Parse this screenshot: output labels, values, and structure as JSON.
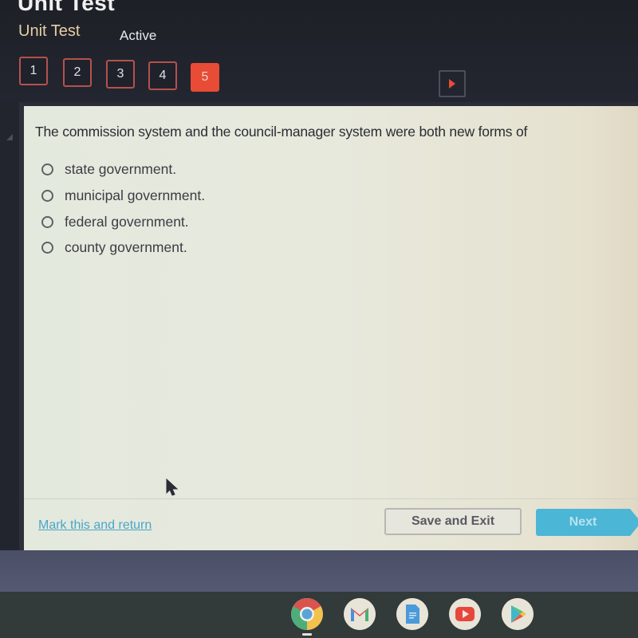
{
  "header": {
    "big_title": "Unit Test",
    "sub_title": "Unit Test",
    "status": "Active"
  },
  "question_nav": {
    "items": [
      {
        "label": "1",
        "active": false
      },
      {
        "label": "2",
        "active": false
      },
      {
        "label": "3",
        "active": false
      },
      {
        "label": "4",
        "active": false
      },
      {
        "label": "5",
        "active": true
      }
    ],
    "next_icon": "play-arrow-icon"
  },
  "question": {
    "text": "The commission system and the council-manager system were both new forms of",
    "options": [
      {
        "label": "state government.",
        "selected": false
      },
      {
        "label": "municipal government.",
        "selected": false
      },
      {
        "label": "federal government.",
        "selected": false
      },
      {
        "label": "county government.",
        "selected": false
      }
    ]
  },
  "footer": {
    "mark_link": "Mark this and return",
    "save_button": "Save and Exit",
    "next_button": "Next"
  },
  "shelf": {
    "apps": [
      "chrome-icon",
      "gmail-icon",
      "docs-icon",
      "youtube-icon",
      "play-store-icon"
    ]
  },
  "colors": {
    "accent_red": "#e84b36",
    "link_blue": "#4ba6c9",
    "next_blue": "#4bb6d6",
    "subtitle_gold": "#e6cfa5"
  }
}
